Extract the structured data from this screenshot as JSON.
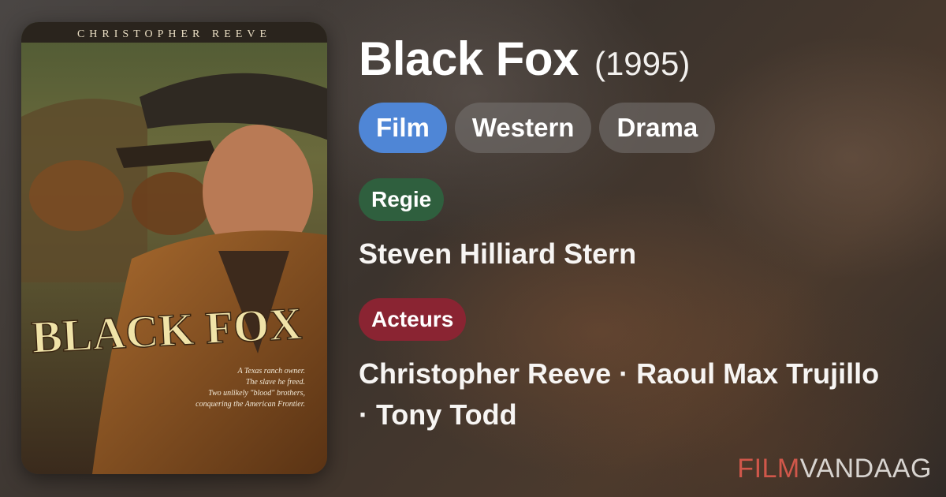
{
  "movie": {
    "title": "Black Fox",
    "year": "(1995)",
    "genres": [
      "Film",
      "Western",
      "Drama"
    ]
  },
  "poster": {
    "top_credit": "CHRISTOPHER REEVE",
    "title_art": "BLACK FOX",
    "tagline": [
      "A Texas ranch owner.",
      "The slave he freed.",
      "Two unlikely \"blood\" brothers,",
      "conquering the American Frontier."
    ]
  },
  "director": {
    "label": "Regie",
    "name": "Steven Hilliard Stern"
  },
  "cast": {
    "label": "Acteurs",
    "line1": "Christopher Reeve · Raoul Max Trujillo",
    "line2": "· Tony Todd"
  },
  "brand": {
    "part1": "FILM",
    "part2": "VANDAAG"
  },
  "colors": {
    "film_chip": "#4f86d6",
    "regie_label": "#2f5f3e",
    "acteurs_label": "#8a2432",
    "brand_accent": "#d0574a"
  }
}
